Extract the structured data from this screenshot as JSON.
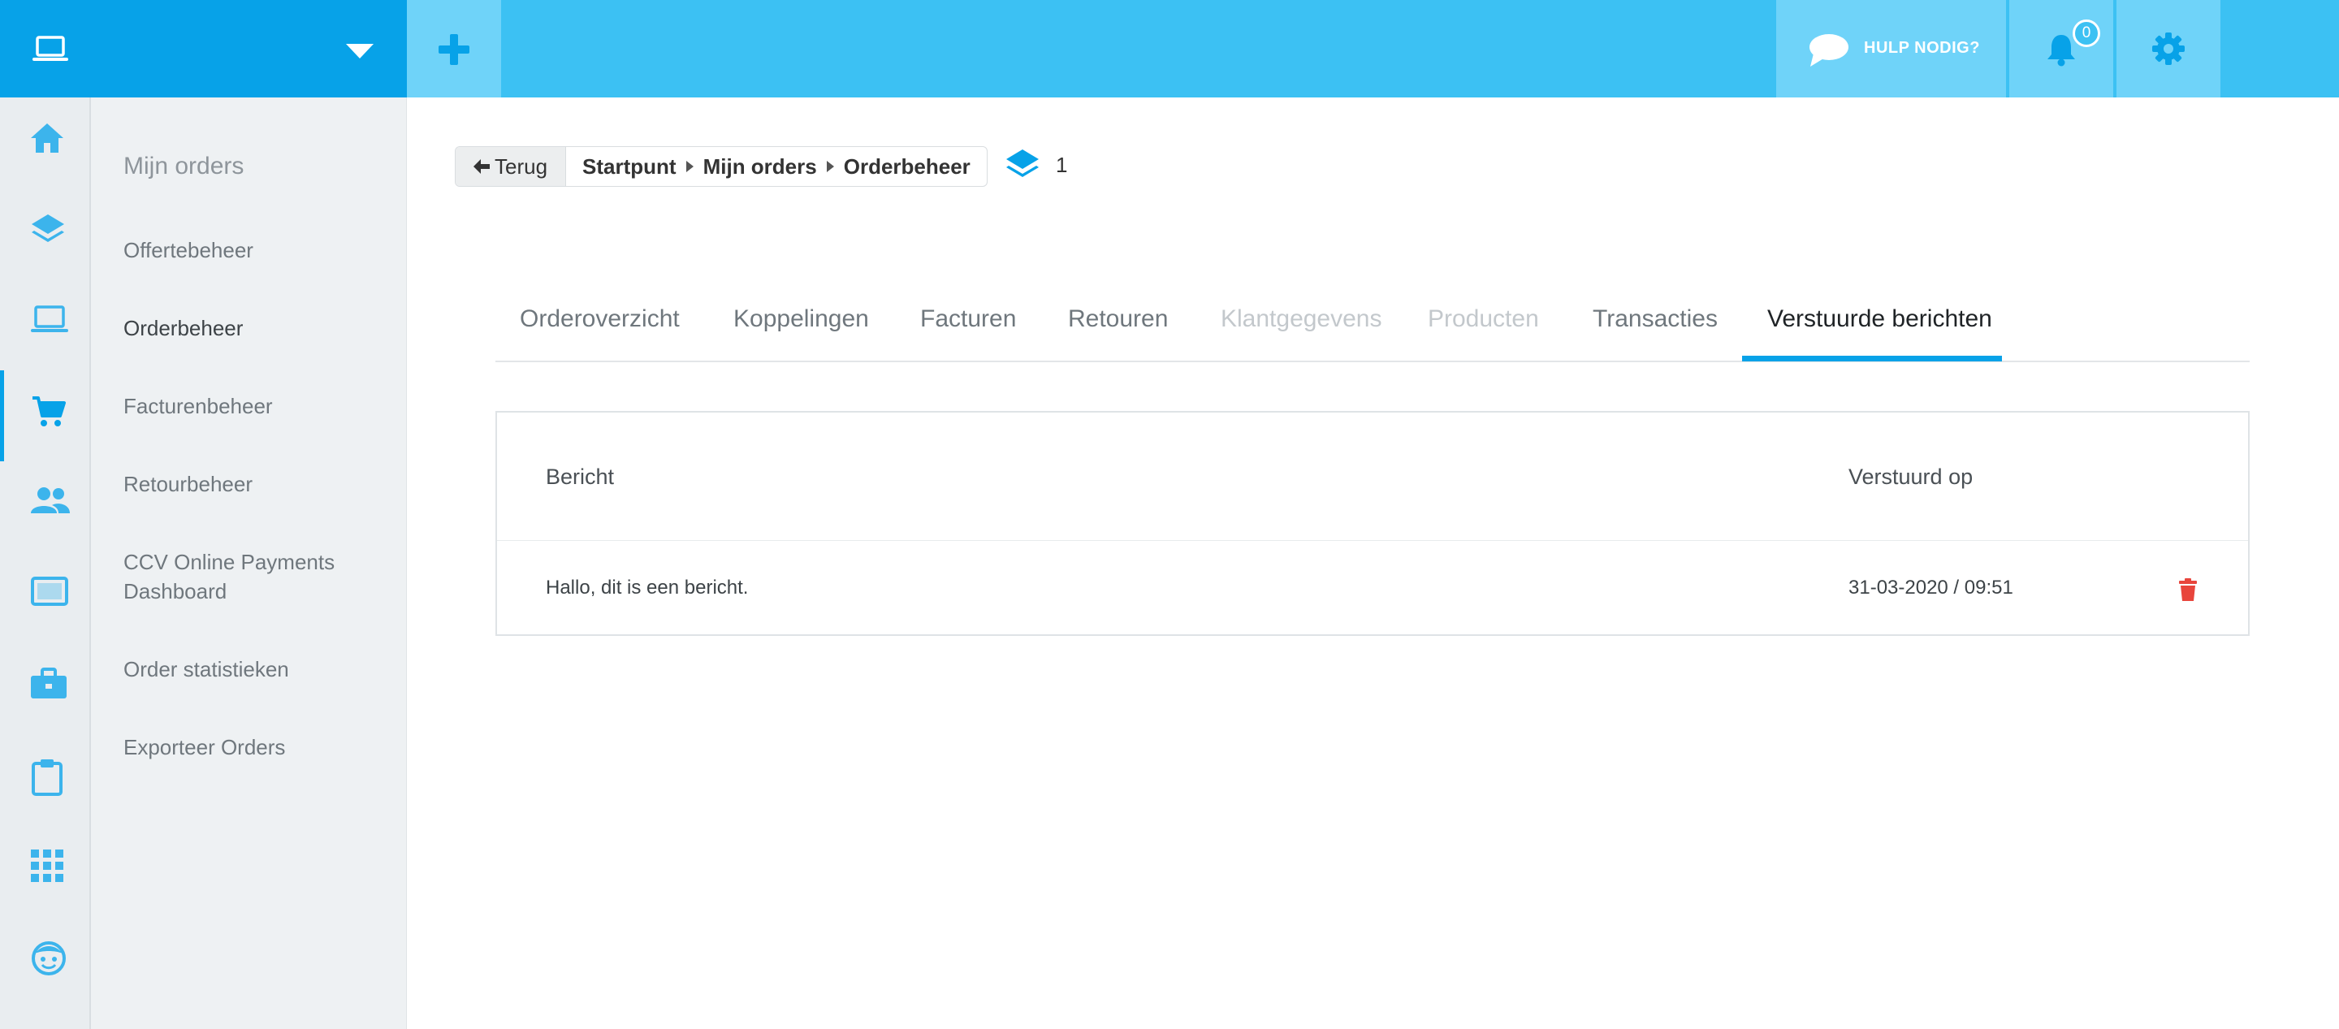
{
  "header": {
    "help_label": "HULP NODIG?",
    "notification_count": "0"
  },
  "submenu": {
    "title": "Mijn orders",
    "items": [
      {
        "label": "Offertebeheer"
      },
      {
        "label": "Orderbeheer"
      },
      {
        "label": "Facturenbeheer"
      },
      {
        "label": "Retourbeheer"
      },
      {
        "label": "CCV Online Payments Dashboard"
      },
      {
        "label": "Order statistieken"
      },
      {
        "label": "Exporteer Orders"
      }
    ]
  },
  "breadcrumb": {
    "back_label": "Terug",
    "items": [
      "Startpunt",
      "Mijn orders",
      "Orderbeheer"
    ]
  },
  "layers_count": "1",
  "tabs": [
    {
      "label": "Orderoverzicht",
      "state": "normal"
    },
    {
      "label": "Koppelingen",
      "state": "normal"
    },
    {
      "label": "Facturen",
      "state": "normal"
    },
    {
      "label": "Retouren",
      "state": "normal"
    },
    {
      "label": "Klantgegevens",
      "state": "disabled"
    },
    {
      "label": "Producten",
      "state": "disabled"
    },
    {
      "label": "Transacties",
      "state": "normal"
    },
    {
      "label": "Verstuurde berichten",
      "state": "active"
    }
  ],
  "table": {
    "columns": [
      "Bericht",
      "Verstuurd op"
    ],
    "rows": [
      {
        "message": "Hallo, dit is een bericht.",
        "sent_on": "31-03-2020 / 09:51"
      }
    ]
  },
  "colors": {
    "brand_blue": "#07a2e8",
    "topbar_blue": "#3cc1f3",
    "delete_red": "#e8453c"
  },
  "icons": {
    "rail": [
      "home-icon",
      "layers-icon",
      "laptop-icon",
      "cart-icon",
      "users-icon",
      "tablet-icon",
      "briefcase-icon",
      "clipboard-icon",
      "apps-grid-icon",
      "smiley-icon"
    ]
  }
}
